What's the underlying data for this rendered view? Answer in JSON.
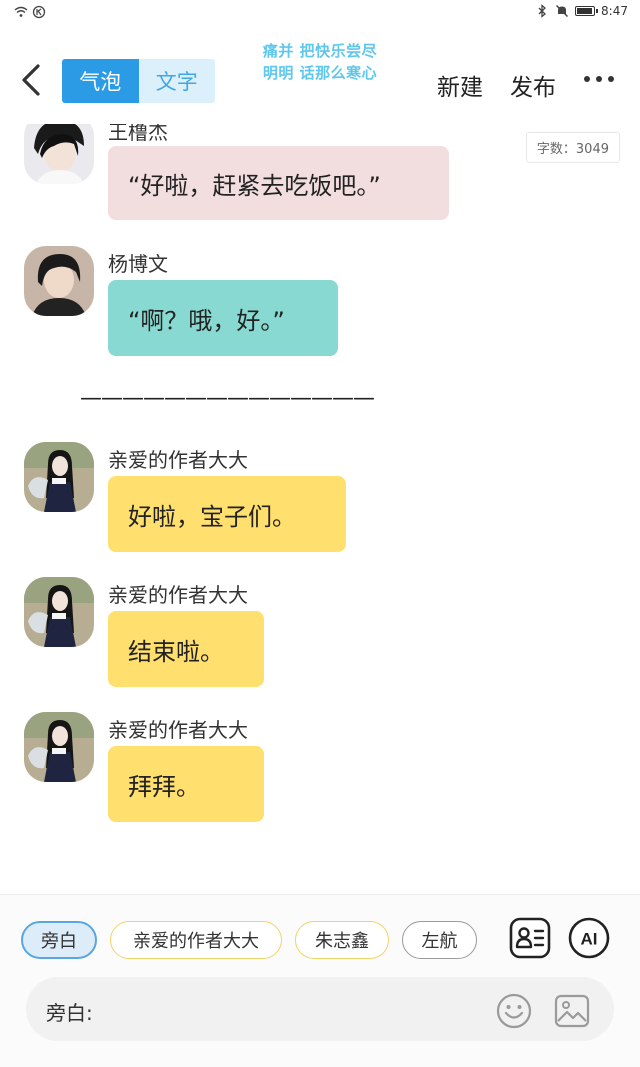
{
  "status_bar": {
    "time": "8:47",
    "battery_level": 0.85
  },
  "header": {
    "mode_tabs": [
      {
        "label": "气泡",
        "active": true
      },
      {
        "label": "文字",
        "active": false
      }
    ],
    "banner_lines": [
      "痛并 把快乐尝尽",
      "明明 话那么寒心"
    ],
    "new_label": "新建",
    "publish_label": "发布"
  },
  "chat": {
    "word_count": "字数：3049",
    "messages": [
      {
        "sender": "王橹杰",
        "text": "“好啦，赶紧去吃饭吧。”",
        "bubble_color": "#f2dede"
      },
      {
        "sender": "杨博文",
        "text": "“啊？哦，好。”",
        "bubble_color": "#88d9d1"
      },
      {
        "sender": "亲爱的作者大大",
        "text": "好啦，宝子们。",
        "bubble_color": "#ffdf6e"
      },
      {
        "sender": "亲爱的作者大大",
        "text": "结束啦。",
        "bubble_color": "#ffdf6e"
      },
      {
        "sender": "亲爱的作者大大",
        "text": "拜拜。",
        "bubble_color": "#ffdf6e"
      }
    ],
    "divider": "——————————————"
  },
  "bottom": {
    "roles": [
      {
        "label": "旁白",
        "selected": true
      },
      {
        "label": "亲爱的作者大大",
        "selected": false
      },
      {
        "label": "朱志鑫",
        "selected": false
      },
      {
        "label": "左航",
        "selected": false
      }
    ],
    "ai_label": "AI",
    "input_label": "旁白:",
    "icons": [
      "contact-card-icon",
      "emoji-icon",
      "image-icon"
    ]
  },
  "colors": {
    "accent": "#2c9be6",
    "accent_light": "#dcf0fb",
    "banner": "#5fc7ee"
  }
}
